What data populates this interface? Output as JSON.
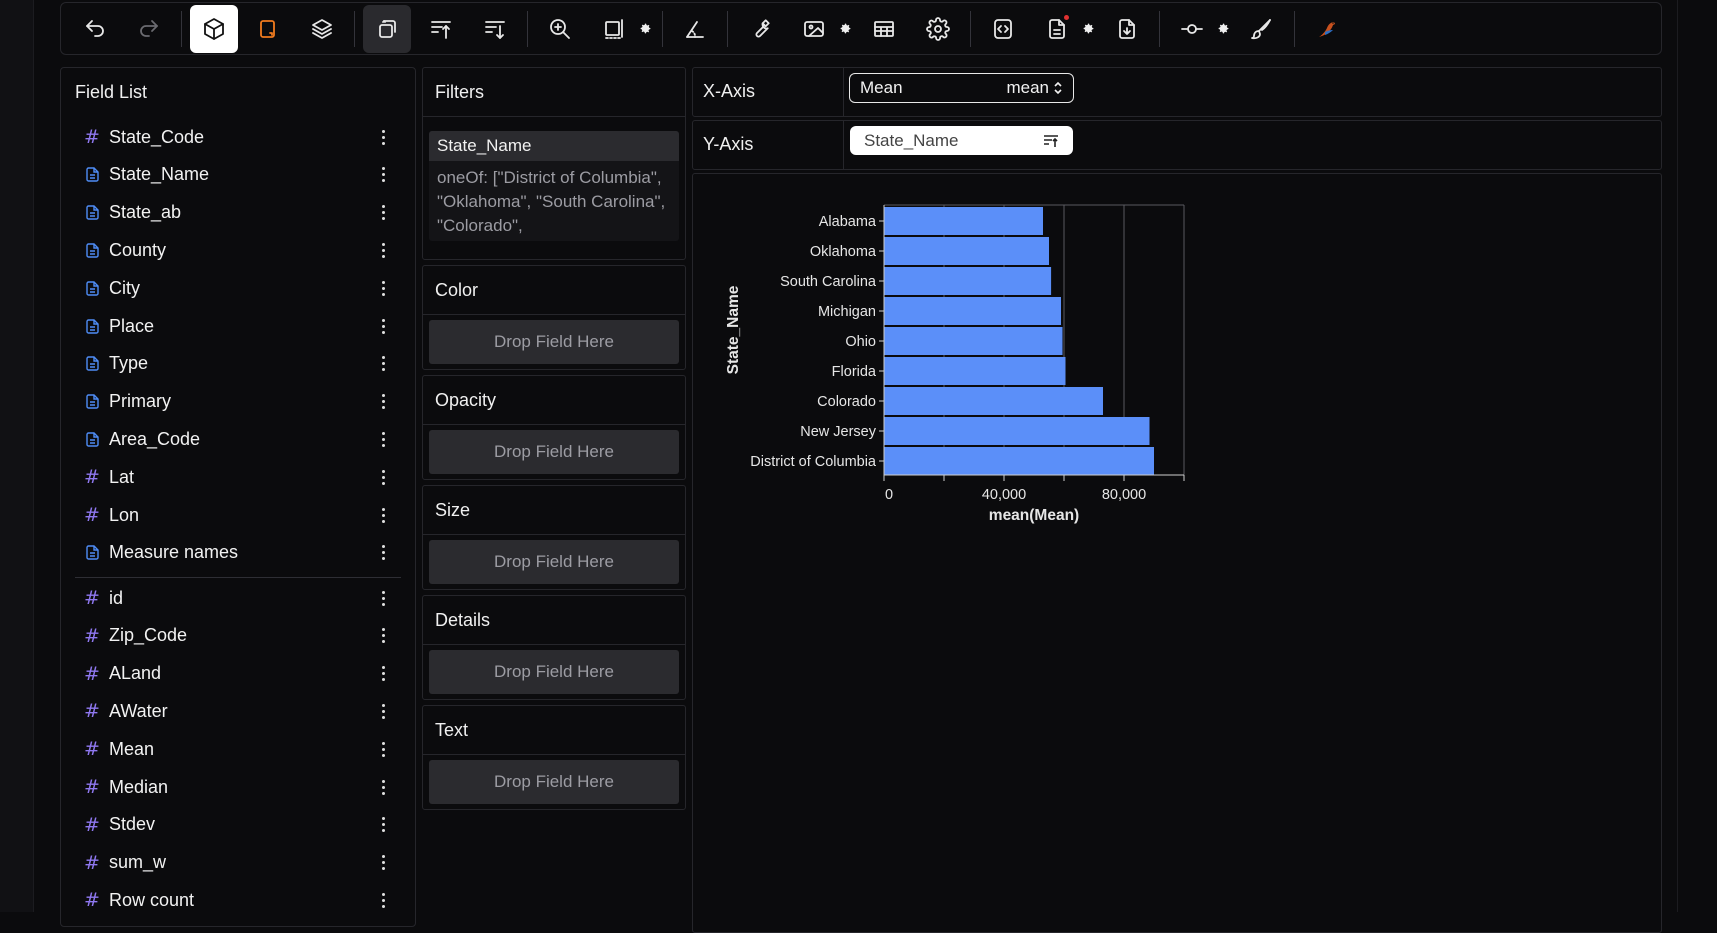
{
  "toolbar": {
    "icons": [
      "undo-icon",
      "redo-icon",
      "cube-icon",
      "square-icon",
      "layers-icon",
      "transpose-icon",
      "sort-ascending-icon",
      "sort-descending-icon",
      "zoom-icon",
      "resize-icon",
      "triangle-icon",
      "wrench-icon",
      "image-icon",
      "table-icon",
      "settings-icon",
      "code-icon",
      "document-icon",
      "download-icon",
      "commit-icon",
      "brush-icon",
      "bird-logo"
    ]
  },
  "field_list": {
    "title": "Field List",
    "dimensions": [
      {
        "name": "State_Code",
        "type": "quantitative"
      },
      {
        "name": "State_Name",
        "type": "nominal"
      },
      {
        "name": "State_ab",
        "type": "nominal"
      },
      {
        "name": "County",
        "type": "nominal"
      },
      {
        "name": "City",
        "type": "nominal"
      },
      {
        "name": "Place",
        "type": "nominal"
      },
      {
        "name": "Type",
        "type": "nominal"
      },
      {
        "name": "Primary",
        "type": "nominal"
      },
      {
        "name": "Area_Code",
        "type": "nominal"
      },
      {
        "name": "Lat",
        "type": "quantitative"
      },
      {
        "name": "Lon",
        "type": "quantitative"
      },
      {
        "name": "Measure names",
        "type": "nominal"
      }
    ],
    "measures": [
      {
        "name": "id",
        "type": "quantitative"
      },
      {
        "name": "Zip_Code",
        "type": "quantitative"
      },
      {
        "name": "ALand",
        "type": "quantitative"
      },
      {
        "name": "AWater",
        "type": "quantitative"
      },
      {
        "name": "Mean",
        "type": "quantitative"
      },
      {
        "name": "Median",
        "type": "quantitative"
      },
      {
        "name": "Stdev",
        "type": "quantitative"
      },
      {
        "name": "sum_w",
        "type": "quantitative"
      },
      {
        "name": "Row count",
        "type": "quantitative"
      }
    ]
  },
  "filters": {
    "title": "Filters",
    "items": [
      {
        "field": "State_Name",
        "rule": "oneOf: [\"District of Columbia\", \"Oklahoma\", \"South Carolina\", \"Colorado\","
      }
    ]
  },
  "encodings": {
    "color": {
      "title": "Color",
      "drop": "Drop Field Here"
    },
    "opacity": {
      "title": "Opacity",
      "drop": "Drop Field Here"
    },
    "size": {
      "title": "Size",
      "drop": "Drop Field Here"
    },
    "details": {
      "title": "Details",
      "drop": "Drop Field Here"
    },
    "text": {
      "title": "Text",
      "drop": "Drop Field Here"
    }
  },
  "x_axis": {
    "label": "X-Axis",
    "field": "Mean",
    "aggregate": "mean"
  },
  "y_axis": {
    "label": "Y-Axis",
    "field": "State_Name"
  },
  "colors": {
    "bar": "#5b8ff9",
    "hash_icon": "#8f78f0",
    "doc_icon": "#4f8df6",
    "accent_orange": "#f07b1f"
  },
  "chart_data": {
    "type": "bar",
    "orientation": "horizontal",
    "categories": [
      "Alabama",
      "Oklahoma",
      "South Carolina",
      "Michigan",
      "Ohio",
      "Florida",
      "Colorado",
      "New Jersey",
      "District of Columbia"
    ],
    "values": [
      53000,
      55000,
      55700,
      59000,
      59500,
      60500,
      73000,
      88500,
      90000
    ],
    "xlabel": "mean(Mean)",
    "ylabel": "State_Name",
    "xlim": [
      0,
      100000
    ],
    "xticks": [
      0,
      20000,
      40000,
      60000,
      80000,
      100000
    ],
    "xtick_labels": [
      "0",
      "40,000",
      "80,000"
    ],
    "grid": true
  }
}
